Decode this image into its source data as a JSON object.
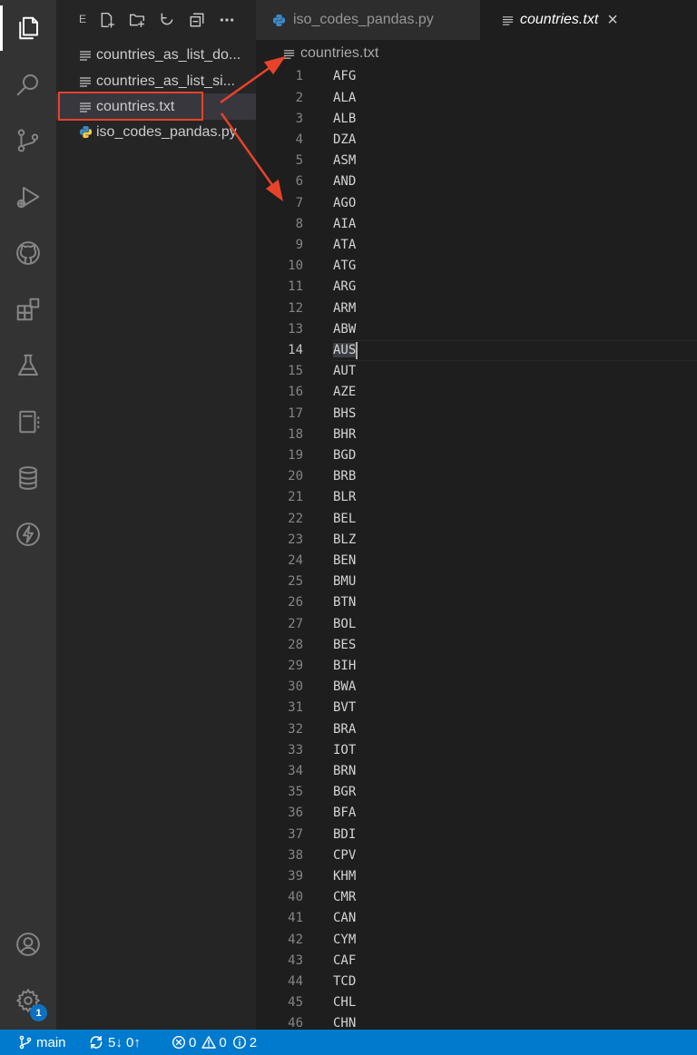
{
  "sidebar": {
    "title": "E",
    "files": [
      {
        "name": "countries_as_list_do...",
        "type": "text"
      },
      {
        "name": "countries_as_list_si...",
        "type": "text"
      },
      {
        "name": "countries.txt",
        "type": "text",
        "selected": true
      },
      {
        "name": "iso_codes_pandas.py",
        "type": "python"
      }
    ]
  },
  "tabs": [
    {
      "label": "iso_codes_pandas.py",
      "type": "python",
      "active": false
    },
    {
      "label": "countries.txt",
      "type": "text",
      "active": true,
      "close": "×"
    }
  ],
  "breadcrumb": {
    "label": "countries.txt"
  },
  "editor": {
    "current_line": 14,
    "lines": [
      "AFG",
      "ALA",
      "ALB",
      "DZA",
      "ASM",
      "AND",
      "AGO",
      "AIA",
      "ATA",
      "ATG",
      "ARG",
      "ARM",
      "ABW",
      "AUS",
      "AUT",
      "AZE",
      "BHS",
      "BHR",
      "BGD",
      "BRB",
      "BLR",
      "BEL",
      "BLZ",
      "BEN",
      "BMU",
      "BTN",
      "BOL",
      "BES",
      "BIH",
      "BWA",
      "BVT",
      "BRA",
      "IOT",
      "BRN",
      "BGR",
      "BFA",
      "BDI",
      "CPV",
      "KHM",
      "CMR",
      "CAN",
      "CYM",
      "CAF",
      "TCD",
      "CHL",
      "CHN"
    ]
  },
  "status_bar": {
    "branch": "main",
    "sync": "5↓ 0↑",
    "errors": "0",
    "warnings": "0",
    "info": "2"
  },
  "activity_bar": {
    "icons": [
      "files-icon",
      "search-icon",
      "source-control-icon",
      "run-debug-icon",
      "github-icon",
      "extensions-icon",
      "testing-icon",
      "notebook-icon",
      "database-icon",
      "lightning-icon"
    ],
    "bottom_icons": [
      "account-icon",
      "settings-gear-icon"
    ],
    "settings_badge": "1"
  },
  "colors": {
    "accent": "#007acc",
    "annotation": "#e8432a",
    "python_icon": "#3b8bc9"
  }
}
